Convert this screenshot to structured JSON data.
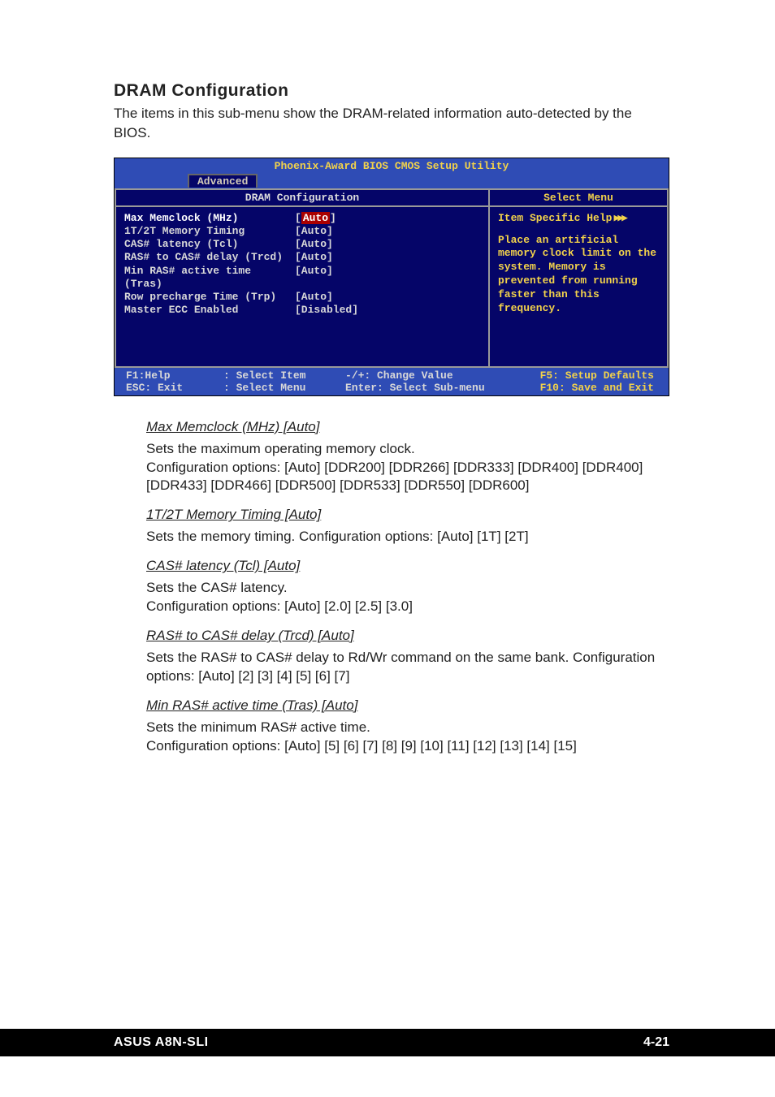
{
  "heading": "DRAM Configuration",
  "intro": "The items in this sub-menu show the DRAM-related information auto-detected by the BIOS.",
  "bios": {
    "title": "Phoenix-Award BIOS CMOS Setup Utility",
    "active_tab": "Advanced",
    "left_header": "DRAM Configuration",
    "right_header": "Select Menu",
    "items": [
      {
        "label": "Max Memclock (MHz)",
        "value": "Auto",
        "selected": true
      },
      {
        "label": "1T/2T Memory Timing",
        "value": "Auto",
        "selected": false
      },
      {
        "label": "CAS# latency (Tcl)",
        "value": "Auto",
        "selected": false
      },
      {
        "label": "RAS# to CAS# delay (Trcd)",
        "value": "Auto",
        "selected": false
      },
      {
        "label": "Min RAS# active time (Tras)",
        "value": "Auto",
        "selected": false
      },
      {
        "label": "Row precharge Time (Trp)",
        "value": "Auto",
        "selected": false
      },
      {
        "label": "Master ECC Enabled",
        "value": "Disabled",
        "selected": false
      }
    ],
    "help_title": "Item Specific Help",
    "help_body": "Place an artificial memory clock limit on the system. Memory is prevented from running faster than this frequency.",
    "footer": {
      "f1": "F1:Help",
      "esc": "ESC: Exit",
      "sel_item": ": Select Item",
      "sel_menu": ": Select Menu",
      "chg": "-/+: Change Value",
      "enter": "Enter: Select Sub-menu",
      "f5": "F5: Setup Defaults",
      "f10": "F10: Save and Exit"
    }
  },
  "options": [
    {
      "title": "Max Memclock (MHz) [Auto]",
      "desc": "Sets the maximum operating memory clock.\nConfiguration options: [Auto] [DDR200] [DDR266] [DDR333] [DDR400] [DDR400] [DDR433] [DDR466] [DDR500] [DDR533] [DDR550] [DDR600]"
    },
    {
      "title": "1T/2T Memory Timing [Auto]",
      "desc": "Sets the memory timing. Configuration options: [Auto] [1T] [2T]"
    },
    {
      "title": "CAS# latency (Tcl) [Auto]",
      "desc": "Sets the CAS# latency.\nConfiguration options: [Auto] [2.0] [2.5] [3.0]"
    },
    {
      "title": "RAS# to CAS# delay (Trcd) [Auto]",
      "desc": "Sets the RAS# to CAS# delay to Rd/Wr command on the same bank. Configuration options: [Auto] [2] [3] [4] [5] [6] [7]"
    },
    {
      "title": "Min RAS# active time (Tras) [Auto]",
      "desc": "Sets the minimum RAS# active time.\nConfiguration options: [Auto] [5] [6] [7] [8] [9] [10] [11] [12] [13] [14] [15]"
    }
  ],
  "footer": {
    "left": "ASUS A8N-SLI",
    "right": "4-21"
  }
}
